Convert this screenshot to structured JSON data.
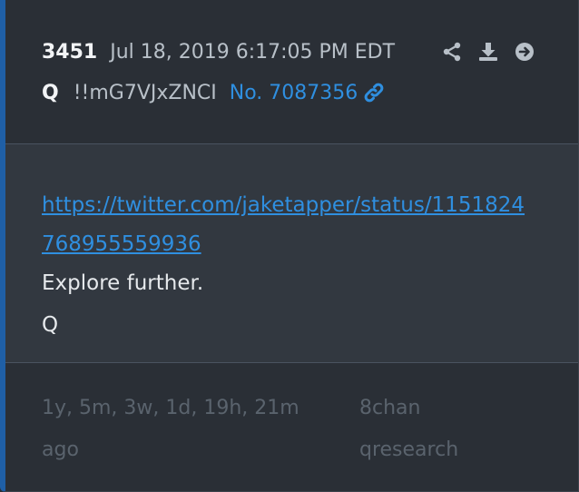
{
  "post": {
    "number": "3451",
    "timestamp": "Jul 18, 2019 6:17:05 PM EDT",
    "author": "Q",
    "tripcode": "!!mG7VJxZNCI",
    "post_no": "No. 7087356"
  },
  "actions": [
    "share-icon",
    "download-icon",
    "arrow-circle-right-icon"
  ],
  "body": {
    "link": "https://twitter.com/jaketapper/status/1151824768955559936",
    "line1": "Explore further.",
    "line2": "Q"
  },
  "footer": {
    "ago": "1y, 5m, 3w, 1d, 19h, 21m ago",
    "board": "8chan qresearch"
  },
  "colors": {
    "accent": "#2f8fe0",
    "left_border": "#1f5fa6",
    "background": "#2a2f36",
    "body_background": "#323840"
  }
}
